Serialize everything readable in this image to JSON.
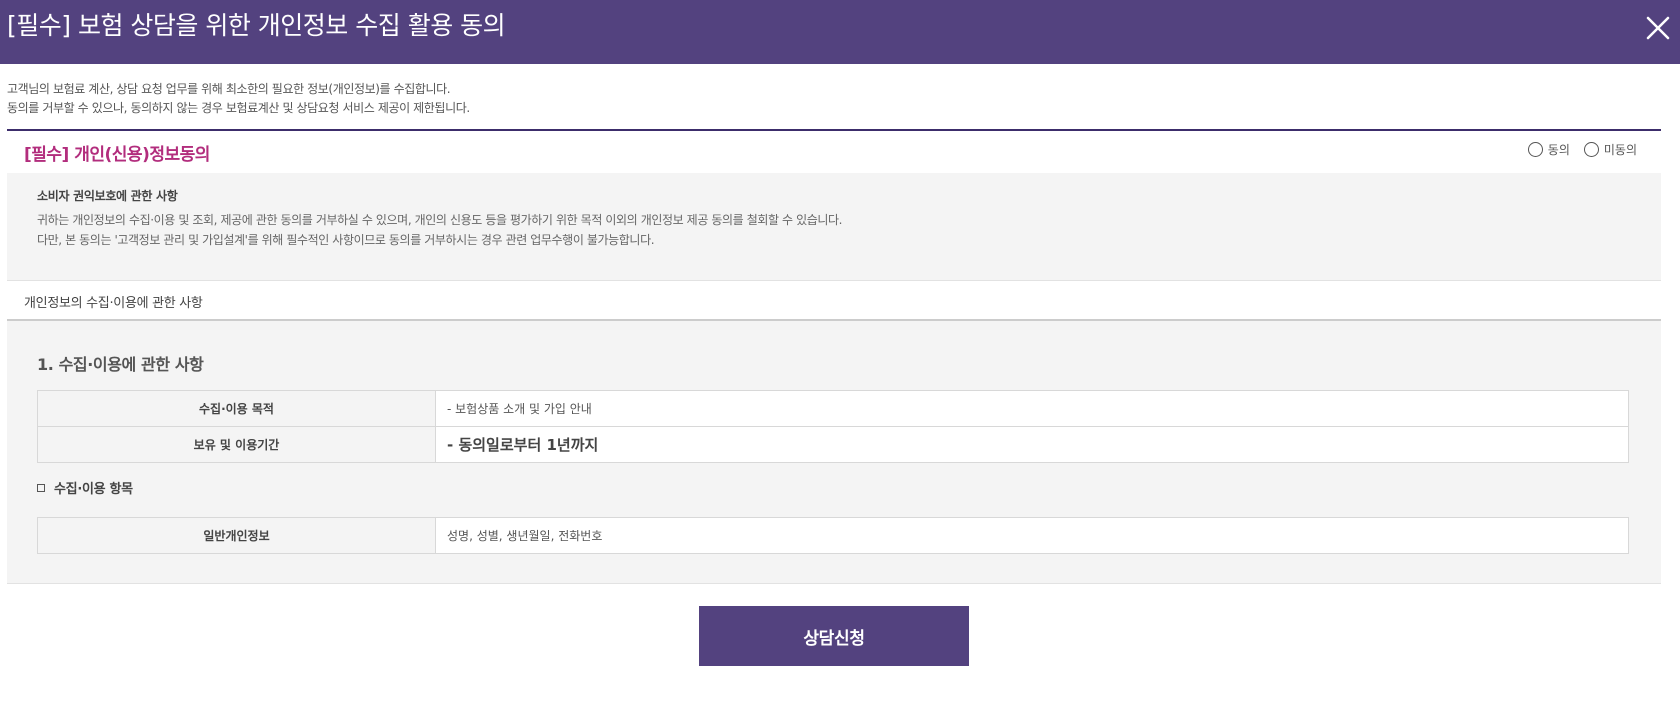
{
  "modal": {
    "title": "[필수] 보험 상담을 위한 개인정보 수집 활용 동의",
    "close_icon": "close-icon",
    "header_color": "#53427f"
  },
  "intro": {
    "line1": "고객님의 보험료 계산, 상담 요청 업무를 위해 최소한의 필요한 정보(개인정보)를 수집합니다.",
    "line2": "동의를 거부할 수 있으나, 동의하지 않는 경우 보험료계산 및 상담요청 서비스 제공이 제한됩니다."
  },
  "consent": {
    "title": "[필수] 개인(신용)정보동의",
    "title_color": "#b22d7d",
    "options": [
      {
        "label": "동의",
        "selected": false
      },
      {
        "label": "미동의",
        "selected": false
      }
    ]
  },
  "rights": {
    "title": "소비자 권익보호에 관한 사항",
    "line1": "귀하는 개인정보의 수집·이용 및 조회, 제공에 관한 동의를 거부하실 수 있으며, 개인의 신용도 등을 평가하기 위한 목적 이외의 개인정보 제공 동의를 철회할 수 있습니다.",
    "line2": "다만, 본 동의는 '고객정보 관리 및 가입설계'를 위해 필수적인 사항이므로 동의를 거부하시는 경우 관련 업무수행이 불가능합니다."
  },
  "collection": {
    "label": "개인정보의 수집·이용에 관한 사항",
    "section_title": "1. 수집·이용에 관한 사항",
    "rows": [
      {
        "header": "수집·이용 목적",
        "value": "- 보험상품 소개 및 가입 안내"
      },
      {
        "header": "보유 및 이용기간",
        "value": "- 동의일로부터 1년까지"
      }
    ],
    "items_label": "수집·이용 항목",
    "items_rows": [
      {
        "header": "일반개인정보",
        "value": "성명, 성별, 생년월일, 전화번호"
      }
    ]
  },
  "submit": {
    "label": "상담신청"
  }
}
